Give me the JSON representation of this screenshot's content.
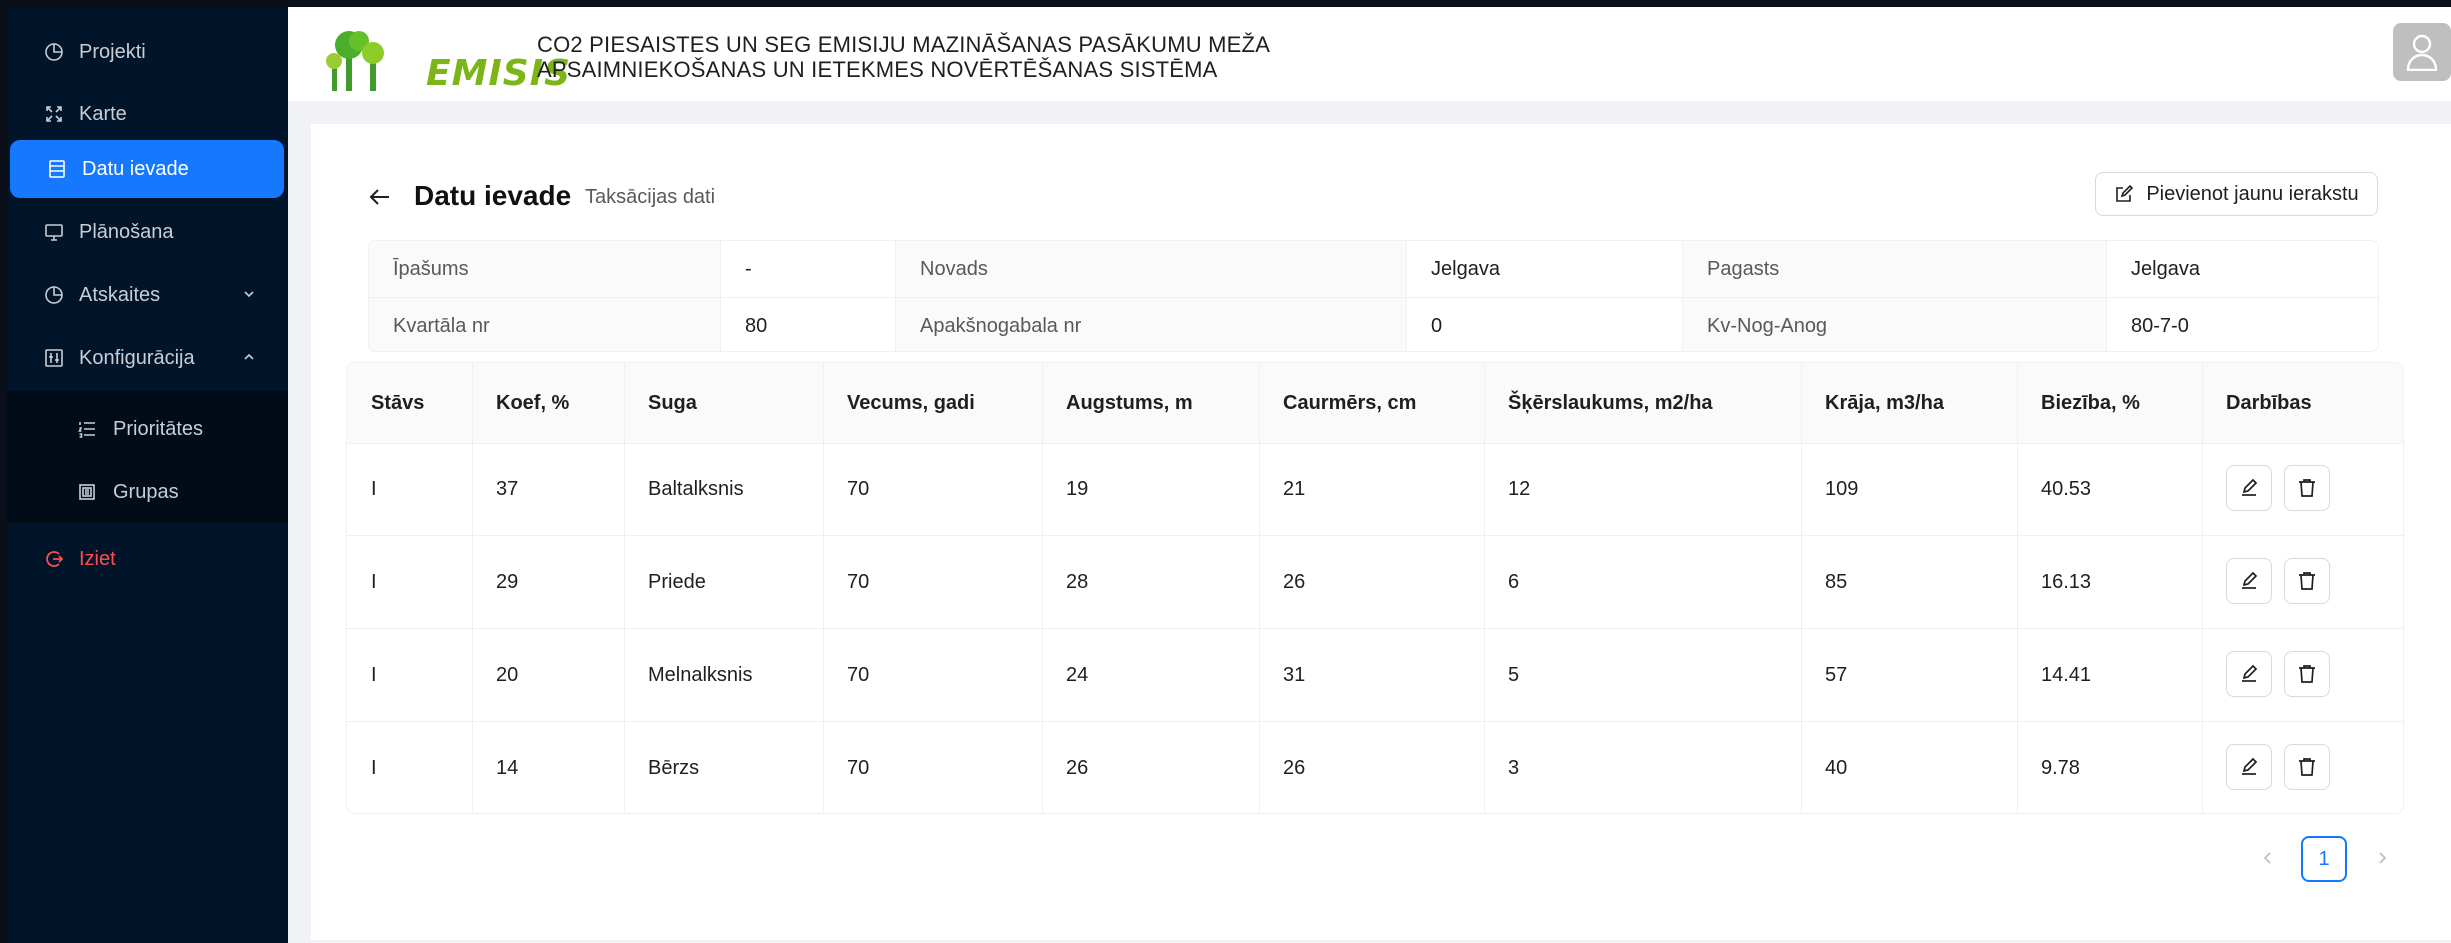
{
  "sidebar": {
    "items": [
      {
        "label": "Projekti",
        "icon": "pie-chart-icon"
      },
      {
        "label": "Karte",
        "icon": "expand-icon"
      },
      {
        "label": "Datu ievade",
        "icon": "data-table-icon",
        "active": true
      },
      {
        "label": "Plānošana",
        "icon": "monitor-icon"
      },
      {
        "label": "Atskaites",
        "icon": "pie-chart-icon"
      },
      {
        "label": "Konfigurācija",
        "icon": "config-icon",
        "expanded": true
      }
    ],
    "submenu": [
      {
        "label": "Prioritātes",
        "icon": "ordered-list-icon"
      },
      {
        "label": "Grupas",
        "icon": "group-icon"
      }
    ],
    "logout": {
      "label": "Iziet",
      "icon": "logout-icon"
    }
  },
  "header": {
    "logo_text": "EMISIS",
    "title_line1": "CO2 PIESAISTES UN SEG EMISIJU MAZINĀŠANAS PASĀKUMU MEŽA",
    "title_line2": "APSAIMNIEKOŠANAS UN IETEKMES NOVĒRTĒŠANAS SISTĒMA"
  },
  "page": {
    "title": "Datu ievade",
    "subtitle": "Taksācijas dati",
    "add_button": "Pievienot jaunu ierakstu"
  },
  "info": {
    "row1": [
      {
        "label": "Īpašums",
        "value": "-"
      },
      {
        "label": "Novads",
        "value": "Jelgava"
      },
      {
        "label": "Pagasts",
        "value": "Jelgava"
      }
    ],
    "row2": [
      {
        "label": "Kvartāla nr",
        "value": "80"
      },
      {
        "label": "Apakšnogabala nr",
        "value": "0"
      },
      {
        "label": "Kv-Nog-Anog",
        "value": "80-7-0"
      }
    ]
  },
  "table": {
    "columns": [
      "Stāvs",
      "Koef, %",
      "Suga",
      "Vecums, gadi",
      "Augstums, m",
      "Caurmērs, cm",
      "Šķērslaukums, m2/ha",
      "Krāja, m3/ha",
      "Biezība, %",
      "Darbības"
    ],
    "rows": [
      [
        "I",
        "37",
        "Baltalksnis",
        "70",
        "19",
        "21",
        "12",
        "109",
        "40.53"
      ],
      [
        "I",
        "29",
        "Priede",
        "70",
        "28",
        "26",
        "6",
        "85",
        "16.13"
      ],
      [
        "I",
        "20",
        "Melnalksnis",
        "70",
        "24",
        "31",
        "5",
        "57",
        "14.41"
      ],
      [
        "I",
        "14",
        "Bērzs",
        "70",
        "26",
        "26",
        "3",
        "40",
        "9.78"
      ]
    ]
  },
  "pagination": {
    "current": "1"
  },
  "colors": {
    "accent": "#1677ff",
    "sidebar": "#001529",
    "logout": "#ff4d4f",
    "logo": "#7cb518"
  }
}
